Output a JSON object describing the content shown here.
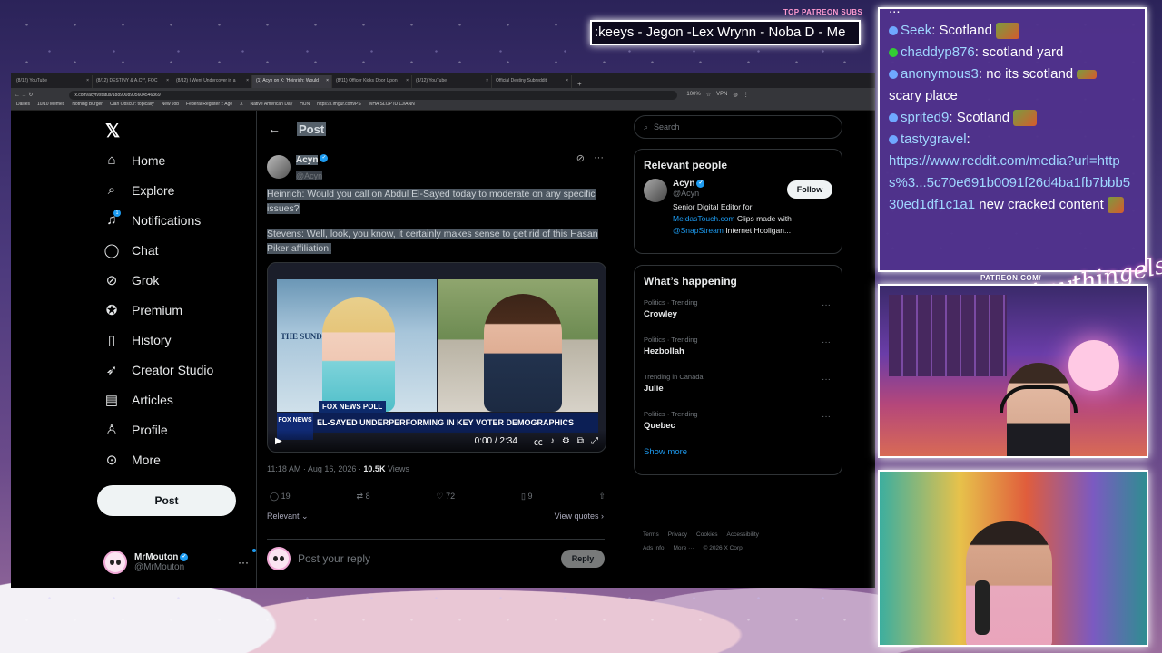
{
  "stream": {
    "patreon_header": "TOP PATREON SUBS",
    "ticker_text": ":keeys - Jegon -Lex Wrynn -  Noba D - Me",
    "patreon_url": "PATREON.COM/",
    "signature": "Anythingelse"
  },
  "browser": {
    "tabs": [
      "(8/12) YouTube",
      "(8/12) DESTINY & A.C**, FOC",
      "(8/12) I Went Undercover in a",
      "(1) Acyn on X: 'Heinrich: Would",
      "(8/11) Officer Kicks Door Upon",
      "(8/12) YouTube",
      "Official Destiny Subreddit"
    ],
    "active_tab": 3,
    "url": "x.com/acyn/status/1889008905604546369",
    "zoom": "100%",
    "vpn": "VPN",
    "bookmarks": [
      "Dailies",
      "10/10 Memes",
      "Nothing Burger",
      "Clan Obscur: topically",
      "New Job",
      "Federal Register :: Age",
      "X",
      "Native American Day",
      "HUN",
      "https://i.imgur.com/PS",
      "WHA SLOP IU LJ/ANN"
    ]
  },
  "nav": {
    "items": [
      {
        "label": "Home",
        "icon": "home-icon"
      },
      {
        "label": "Explore",
        "icon": "search-icon"
      },
      {
        "label": "Notifications",
        "icon": "bell-icon",
        "badge": "1"
      },
      {
        "label": "Chat",
        "icon": "chat-icon"
      },
      {
        "label": "Grok",
        "icon": "grok-icon"
      },
      {
        "label": "Premium",
        "icon": "premium-icon"
      },
      {
        "label": "History",
        "icon": "bookmark-icon"
      },
      {
        "label": "Creator Studio",
        "icon": "rocket-icon"
      },
      {
        "label": "Articles",
        "icon": "article-icon"
      },
      {
        "label": "Profile",
        "icon": "person-icon"
      },
      {
        "label": "More",
        "icon": "more-circle-icon"
      }
    ],
    "post_button": "Post",
    "account": {
      "name": "MrMouton",
      "handle": "@MrMouton"
    }
  },
  "post": {
    "header": "Post",
    "author_name": "Acyn",
    "author_handle": "@Acyn",
    "text1": "Heinrich: Would you call on Abdul El-Sayed today to moderate on any specific issues?",
    "text2": "Stevens: Well, look, you know, it certainly makes sense to get rid of this Hasan Piker affiliation.",
    "video": {
      "chyron": "EL-SAYED UNDERPERFORMING IN KEY VOTER DEMOGRAPHICS",
      "poll_tag": "FOX NEWS POLL",
      "network": "FOX NEWS",
      "show": "THE SUNDA",
      "time": "0:00 / 2:34"
    },
    "timestamp": "11:18 AM · Aug 16, 2026 ·",
    "views_count": "10.5K",
    "views_label": "Views",
    "replies": "19",
    "reposts": "8",
    "likes": "72",
    "bookmarks": "9",
    "relevant": "Relevant",
    "view_quotes": "View quotes",
    "reply_placeholder": "Post your reply",
    "reply_button": "Reply"
  },
  "sidebar": {
    "search_placeholder": "Search",
    "relevant_title": "Relevant people",
    "person": {
      "name": "Acyn",
      "handle": "@Acyn",
      "follow": "Follow",
      "bio1": "Senior Digital Editor for",
      "bio_link1": "MeidasTouch.com",
      "bio2": " Clips made with",
      "bio_link2": "@SnapStream",
      "bio3": " Internet Hooligan..."
    },
    "happening_title": "What’s happening",
    "trends": [
      {
        "context": "Politics · Trending",
        "topic": "Crowley"
      },
      {
        "context": "Politics · Trending",
        "topic": "Hezbollah"
      },
      {
        "context": "Trending in Canada",
        "topic": "Julie"
      },
      {
        "context": "Politics · Trending",
        "topic": "Quebec"
      }
    ],
    "show_more": "Show more",
    "footer": [
      "Terms",
      "Privacy",
      "Cookies",
      "Accessibility",
      "Ads info",
      "More ···",
      "© 2026 X Corp."
    ]
  },
  "chat": {
    "partial_top": "...",
    "messages": [
      {
        "user": "Seek",
        "text": ": Scotland"
      },
      {
        "user": "chaddyp876",
        "text": ": scotland yard"
      },
      {
        "user": "anonymous3",
        "text": ": no its scotland",
        "cont": "scary place"
      },
      {
        "user": "sprited9",
        "text": ": Scotland"
      },
      {
        "user": "tastygravel",
        "text": ":",
        "link": "https://www.reddit.com/media?url=https%3...5c70e691b0091f26d4ba1fb7bbb530ed1df1c1a1",
        "after": " new cracked content"
      }
    ]
  }
}
